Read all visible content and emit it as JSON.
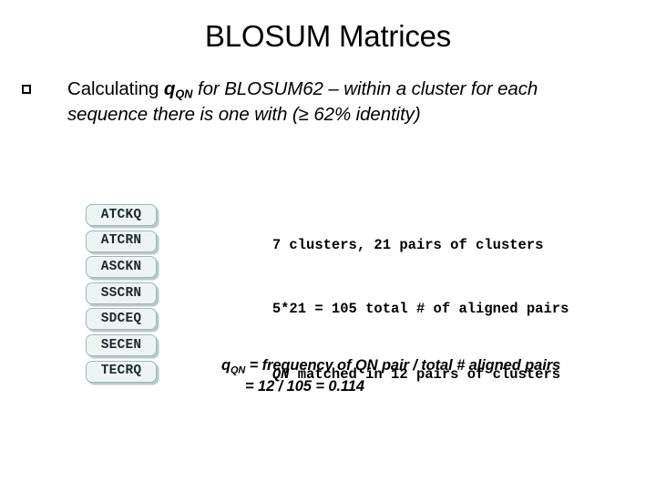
{
  "slide": {
    "title": "BLOSUM Matrices",
    "bullet": {
      "marker_icon": "hollow-square-bullet-icon",
      "lead_upright": "Calculating ",
      "q_symbol": "q",
      "q_subscript": "QN",
      "rest_line1": " for BLOSUM62 – within a cluster for each",
      "line2": "sequence there is one with (≥ 62% identity)"
    },
    "sequences": [
      "ATCKQ",
      "ATCRN",
      "ASCKN",
      "SSCRN",
      "SDCEQ",
      "SECEN",
      "TECRQ"
    ],
    "notes": [
      {
        "italic_prefix": "",
        "text": "7 clusters, 21 pairs of clusters"
      },
      {
        "italic_prefix": "",
        "text": "5*21 = 105 total # of aligned pairs"
      },
      {
        "italic_prefix": "QN",
        "text": " matched in 12 pairs of clusters"
      }
    ],
    "formula": {
      "q_symbol": "q",
      "q_subscript": "QN",
      "line1": " = frequency of QN pair /  total # aligned pairs",
      "line2": "= 12 / 105 = 0.114"
    },
    "colors": {
      "box_fill": "#eef4f4",
      "box_border": "#9fb7bb",
      "box_shadow": "#b9c9cc",
      "text": "#000000",
      "background": "#ffffff"
    }
  }
}
